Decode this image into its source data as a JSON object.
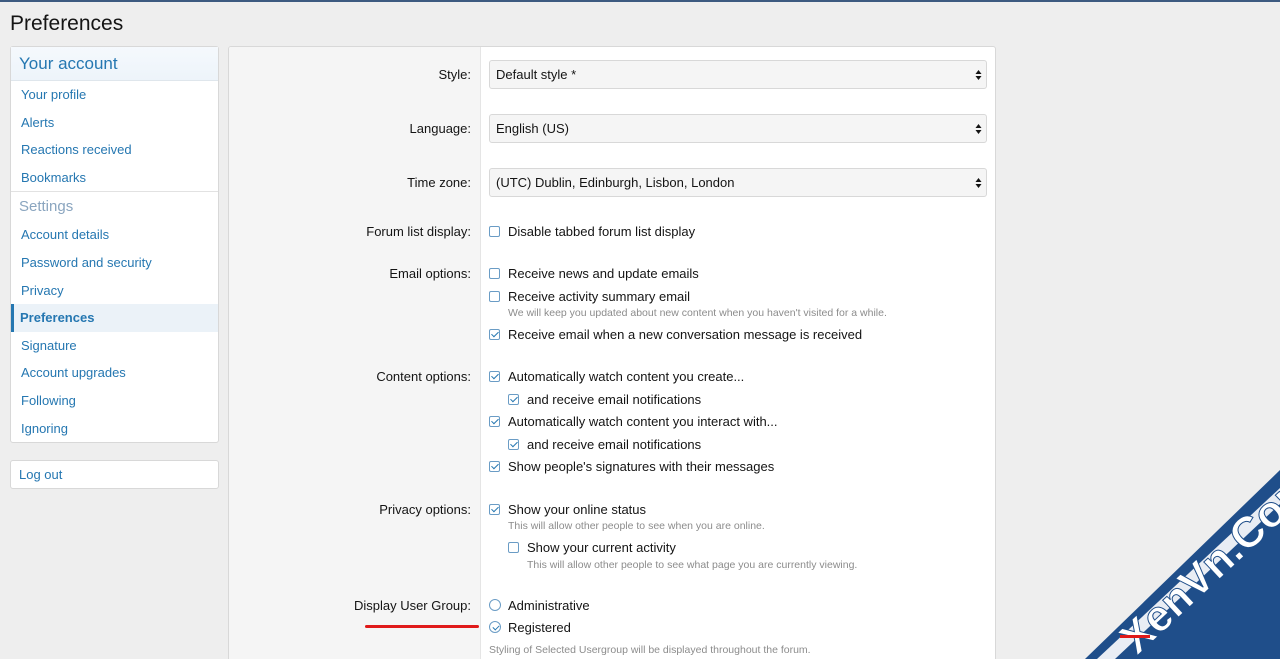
{
  "page": {
    "title": "Preferences"
  },
  "sidebar": {
    "header": "Your account",
    "account_items": [
      {
        "label": "Your profile"
      },
      {
        "label": "Alerts"
      },
      {
        "label": "Reactions received"
      },
      {
        "label": "Bookmarks"
      }
    ],
    "settings_header": "Settings",
    "settings_items": [
      {
        "label": "Account details"
      },
      {
        "label": "Password and security"
      },
      {
        "label": "Privacy"
      },
      {
        "label": "Preferences",
        "active": true
      },
      {
        "label": "Signature"
      },
      {
        "label": "Account upgrades"
      },
      {
        "label": "Following"
      },
      {
        "label": "Ignoring"
      }
    ],
    "logout": "Log out"
  },
  "form": {
    "style": {
      "label": "Style:",
      "value": "Default style *"
    },
    "language": {
      "label": "Language:",
      "value": "English (US)"
    },
    "timezone": {
      "label": "Time zone:",
      "value": "(UTC) Dublin, Edinburgh, Lisbon, London"
    },
    "forum_list": {
      "label": "Forum list display:",
      "option": "Disable tabbed forum list display",
      "checked": false
    },
    "email": {
      "label": "Email options:",
      "news": {
        "text": "Receive news and update emails",
        "checked": false
      },
      "activity": {
        "text": "Receive activity summary email",
        "checked": false,
        "hint": "We will keep you updated about new content when you haven't visited for a while."
      },
      "conversation": {
        "text": "Receive email when a new conversation message is received",
        "checked": true
      }
    },
    "content": {
      "label": "Content options:",
      "watch_create": {
        "text": "Automatically watch content you create...",
        "checked": true
      },
      "watch_create_email": {
        "text": "and receive email notifications",
        "checked": true
      },
      "watch_interact": {
        "text": "Automatically watch content you interact with...",
        "checked": true
      },
      "watch_interact_email": {
        "text": "and receive email notifications",
        "checked": true
      },
      "signatures": {
        "text": "Show people's signatures with their messages",
        "checked": true
      }
    },
    "privacy": {
      "label": "Privacy options:",
      "online": {
        "text": "Show your online status",
        "checked": true,
        "hint": "This will allow other people to see when you are online."
      },
      "activity": {
        "text": "Show your current activity",
        "checked": false,
        "hint": "This will allow other people to see what page you are currently viewing."
      }
    },
    "usergroup": {
      "label": "Display User Group:",
      "options": [
        {
          "text": "Administrative",
          "selected": false
        },
        {
          "text": "Registered",
          "selected": true
        }
      ],
      "hint": "Styling of Selected Usergroup will be displayed throughout the forum."
    }
  },
  "watermark": {
    "text": "XenVn.Com",
    "colors": {
      "bg": "#1f4e8a",
      "fg": "#ffffff",
      "accent": "#e01a1a"
    }
  }
}
